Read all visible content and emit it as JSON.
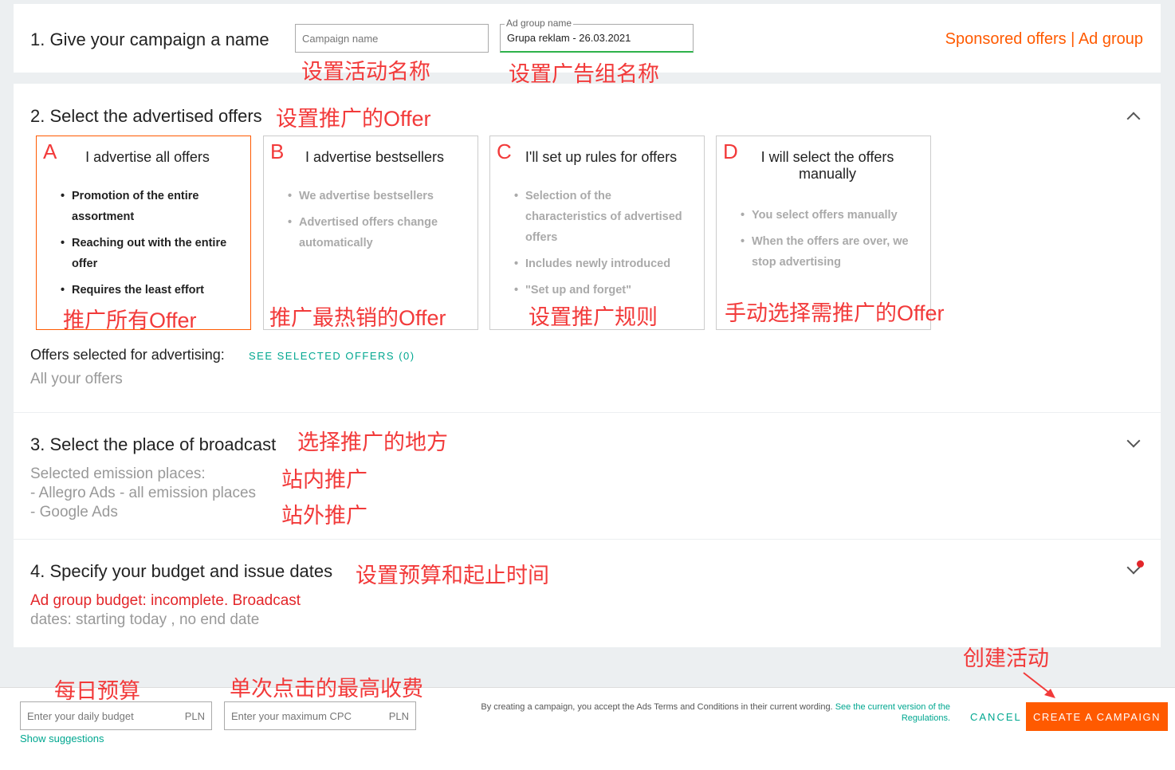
{
  "header": {
    "brand": "Sponsored offers",
    "separator": "|",
    "crumb": "Ad group"
  },
  "s1": {
    "title": "1. Give your campaign a name",
    "campaign_placeholder": "Campaign name",
    "adgroup_label": "Ad group name",
    "adgroup_value": "Grupa reklam - 26.03.2021",
    "ann_campaign": "设置活动名称",
    "ann_adgroup": "设置广告组名称"
  },
  "s2": {
    "title": "2. Select the advertised offers",
    "ann": "设置推广的",
    "ann_en": "Offer",
    "cards": [
      {
        "letter": "A",
        "title": "I advertise all offers",
        "items": [
          "Promotion of the entire assortment",
          "Reaching out with the entire offer",
          "Requires the least effort"
        ],
        "ann": "推广所有",
        "ann_en": "Offer"
      },
      {
        "letter": "B",
        "title": "I advertise bestsellers",
        "items": [
          "We advertise bestsellers",
          "Advertised offers change automatically"
        ],
        "ann": "推广最热销的",
        "ann_en": "Offer"
      },
      {
        "letter": "C",
        "title": "I'll set up rules for offers",
        "items": [
          "Selection of the characteristics of advertised offers",
          "Includes newly introduced",
          "\"Set up and forget\""
        ],
        "ann": "设置推广规则",
        "ann_en": ""
      },
      {
        "letter": "D",
        "title": "I will select the offers manually",
        "items": [
          "You select offers manually",
          "When the offers are over, we stop advertising"
        ],
        "ann": "手动选择需推广的",
        "ann_en": "Offer"
      }
    ],
    "selected_label": "Offers selected for advertising:",
    "see_selected": "SEE SELECTED OFFERS (0)",
    "all_offers": "All your offers"
  },
  "s3": {
    "title": "3. Select the place of broadcast",
    "ann": "选择推广的地方",
    "places_label": "Selected emission places:",
    "place1": "- Allegro Ads - all emission places",
    "place2": "- Google Ads",
    "ann1": "站内推广",
    "ann2": "站外推广"
  },
  "s4": {
    "title": "4. Specify your budget and issue dates",
    "ann": "设置预算和起止时间",
    "status_red": "Ad group budget: incomplete. Broadcast",
    "status_grey": "dates: starting today , no end date"
  },
  "footer": {
    "daily_placeholder": "Enter your daily budget",
    "cpc_placeholder": "Enter your maximum CPC",
    "currency": "PLN",
    "show_suggestions": "Show suggestions",
    "terms": "By creating a campaign, you accept the Ads Terms and Conditions in their current wording.",
    "terms_link": "See the current version of the Regulations.",
    "cancel": "CANCEL",
    "create": "CREATE A CAMPAIGN",
    "ann_daily": "每日预算",
    "ann_cpc": "单次点击的最高收费",
    "ann_create": "创建活动"
  },
  "colors": {
    "accent": "#ff5a00",
    "teal": "#00a790",
    "annotation": "#f23a3a"
  }
}
